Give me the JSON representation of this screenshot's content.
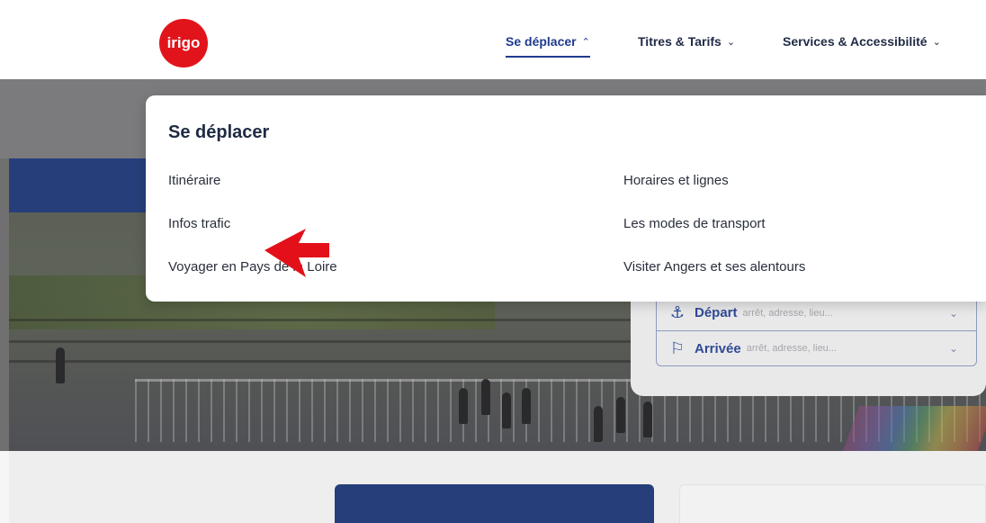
{
  "header": {
    "logo_text": "irigo",
    "nav": [
      {
        "label": "Se déplacer",
        "chevron": "^"
      },
      {
        "label": "Titres & Tarifs",
        "chevron": "v"
      },
      {
        "label": "Services & Accessibilité",
        "chevron": "v"
      }
    ]
  },
  "dropdown": {
    "title": "Se déplacer",
    "left_links": [
      "Itinéraire",
      "Infos trafic",
      "Voyager en Pays de la Loire"
    ],
    "right_links": [
      "Horaires et lignes",
      "Les modes de transport",
      "Visiter Angers et ses alentours"
    ]
  },
  "search": {
    "depart": {
      "label": "Départ",
      "placeholder": "arrêt, adresse, lieu..."
    },
    "arrivee": {
      "label": "Arrivée",
      "placeholder": "arrêt, adresse, lieu..."
    }
  },
  "colors": {
    "brand_red": "#e2141b",
    "nav_blue": "#1f3b8f",
    "band_blue": "#263f7a",
    "annotation_red": "#e3101a"
  },
  "icons": {
    "depart": "anchor-pin-icon",
    "arrivee": "flag-icon",
    "chevron": "chevron-down-icon",
    "annotation": "red-arrow-left-icon"
  }
}
